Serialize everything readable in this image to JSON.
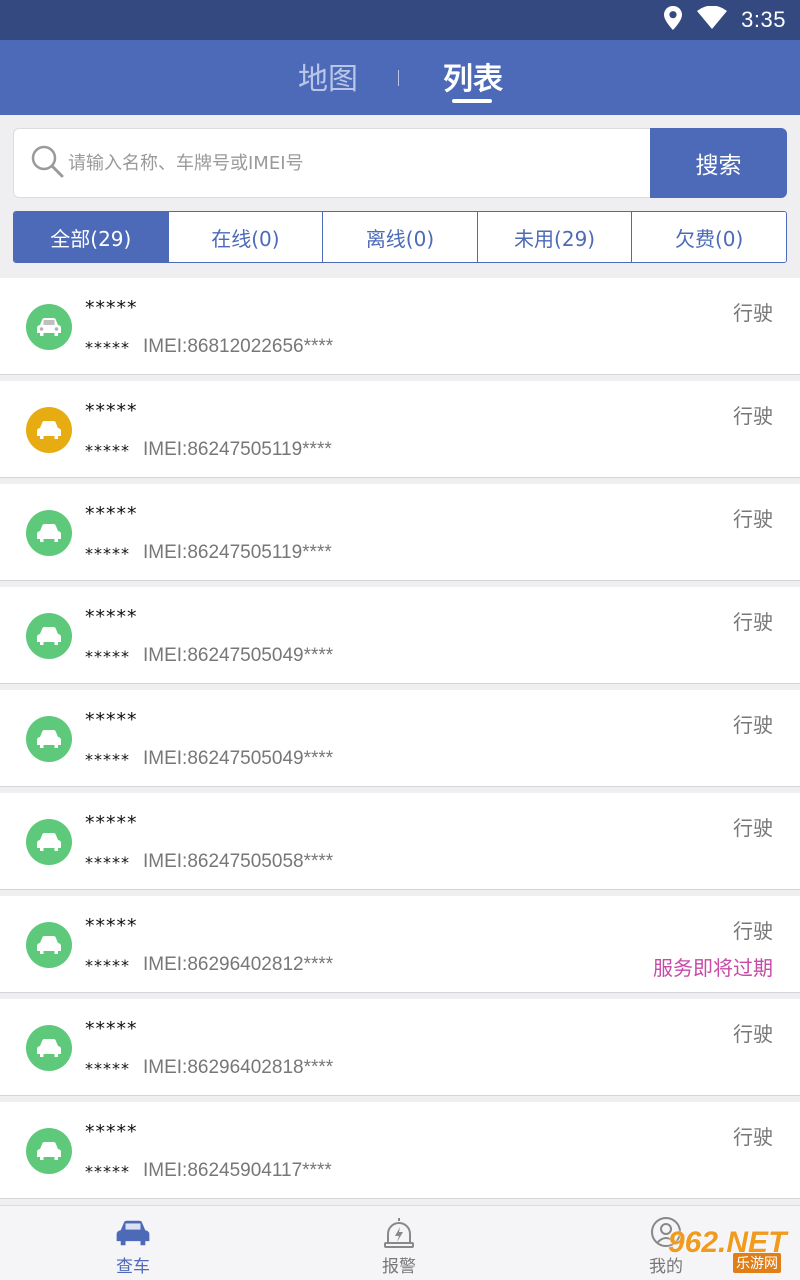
{
  "status_bar": {
    "time": "3:35"
  },
  "header": {
    "tabs": [
      {
        "label": "地图",
        "active": false
      },
      {
        "label": "列表",
        "active": true
      }
    ]
  },
  "search": {
    "placeholder": "请输入名称、车牌号或IMEI号",
    "value": "",
    "button_label": "搜索"
  },
  "filters": [
    {
      "label": "全部(29)",
      "active": true
    },
    {
      "label": "在线(0)",
      "active": false
    },
    {
      "label": "离线(0)",
      "active": false
    },
    {
      "label": "未用(29)",
      "active": false
    },
    {
      "label": "欠费(0)",
      "active": false
    }
  ],
  "vehicles": [
    {
      "name": "*****",
      "plate": "*****",
      "imei": "IMEI:86812022656****",
      "status": "行驶",
      "warning": "",
      "icon_color": "#5ec97a"
    },
    {
      "name": "*****",
      "plate": "*****",
      "imei": "IMEI:86247505119****",
      "status": "行驶",
      "warning": "",
      "icon_color": "#e8ac13"
    },
    {
      "name": "*****",
      "plate": "*****",
      "imei": "IMEI:86247505119****",
      "status": "行驶",
      "warning": "",
      "icon_color": "#5ec97a"
    },
    {
      "name": "*****",
      "plate": "*****",
      "imei": "IMEI:86247505049****",
      "status": "行驶",
      "warning": "",
      "icon_color": "#5ec97a"
    },
    {
      "name": "*****",
      "plate": "*****",
      "imei": "IMEI:86247505049****",
      "status": "行驶",
      "warning": "",
      "icon_color": "#5ec97a"
    },
    {
      "name": "*****",
      "plate": "*****",
      "imei": "IMEI:86247505058****",
      "status": "行驶",
      "warning": "",
      "icon_color": "#5ec97a"
    },
    {
      "name": "*****",
      "plate": "*****",
      "imei": "IMEI:86296402812****",
      "status": "行驶",
      "warning": "服务即将过期",
      "icon_color": "#5ec97a"
    },
    {
      "name": "*****",
      "plate": "*****",
      "imei": "IMEI:86296402818****",
      "status": "行驶",
      "warning": "",
      "icon_color": "#5ec97a"
    },
    {
      "name": "*****",
      "plate": "*****",
      "imei": "IMEI:86245904117****",
      "status": "行驶",
      "warning": "",
      "icon_color": "#5ec97a"
    }
  ],
  "bottom_nav": [
    {
      "label": "查车",
      "icon": "car-icon",
      "active": true
    },
    {
      "label": "报警",
      "icon": "alarm-icon",
      "active": false
    },
    {
      "label": "我的",
      "icon": "user-icon",
      "active": false
    }
  ],
  "watermark": {
    "text": "962.NET",
    "subtext": "乐游网"
  },
  "colors": {
    "primary": "#4d6ab8",
    "status_bar": "#34497f",
    "online_green": "#5ec97a",
    "alert_yellow": "#e8ac13",
    "warning_pink": "#c84aa6"
  }
}
